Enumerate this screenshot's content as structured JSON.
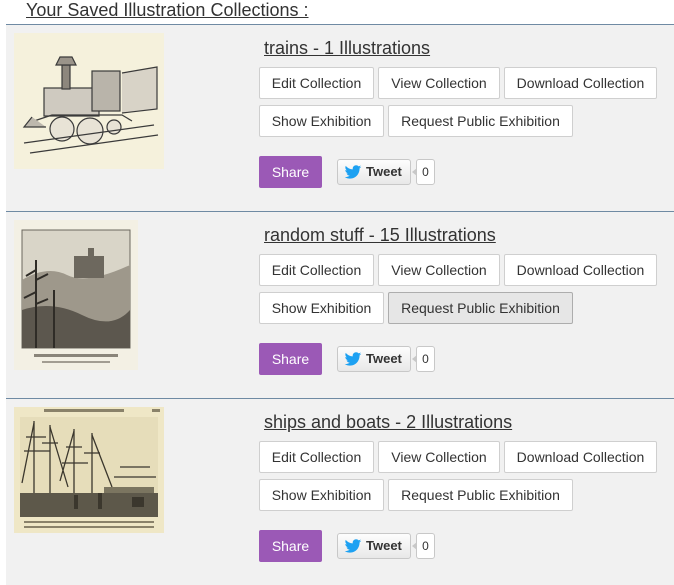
{
  "page": {
    "heading": "Your Saved Illustration Collections :"
  },
  "labels": {
    "edit": "Edit Collection",
    "view": "View Collection",
    "download": "Download Collection",
    "show": "Show Exhibition",
    "request": "Request Public Exhibition",
    "share": "Share",
    "tweet": "Tweet"
  },
  "collections": [
    {
      "title": "trains - 1 Illustrations",
      "tweet_count": "0",
      "thumbnail": "steam-locomotive-engraving"
    },
    {
      "title": "random stuff - 15 Illustrations",
      "tweet_count": "0",
      "thumbnail": "castle-landscape-engraving"
    },
    {
      "title": "ships and boats - 2 Illustrations",
      "tweet_count": "0",
      "thumbnail": "sailing-ships-harbor-engraving"
    }
  ],
  "colors": {
    "share": "#9b59b6",
    "twitter_bird": "#1da1f2",
    "divider": "#6f8aa3"
  },
  "icons": {
    "tweet": "twitter-bird-icon"
  }
}
